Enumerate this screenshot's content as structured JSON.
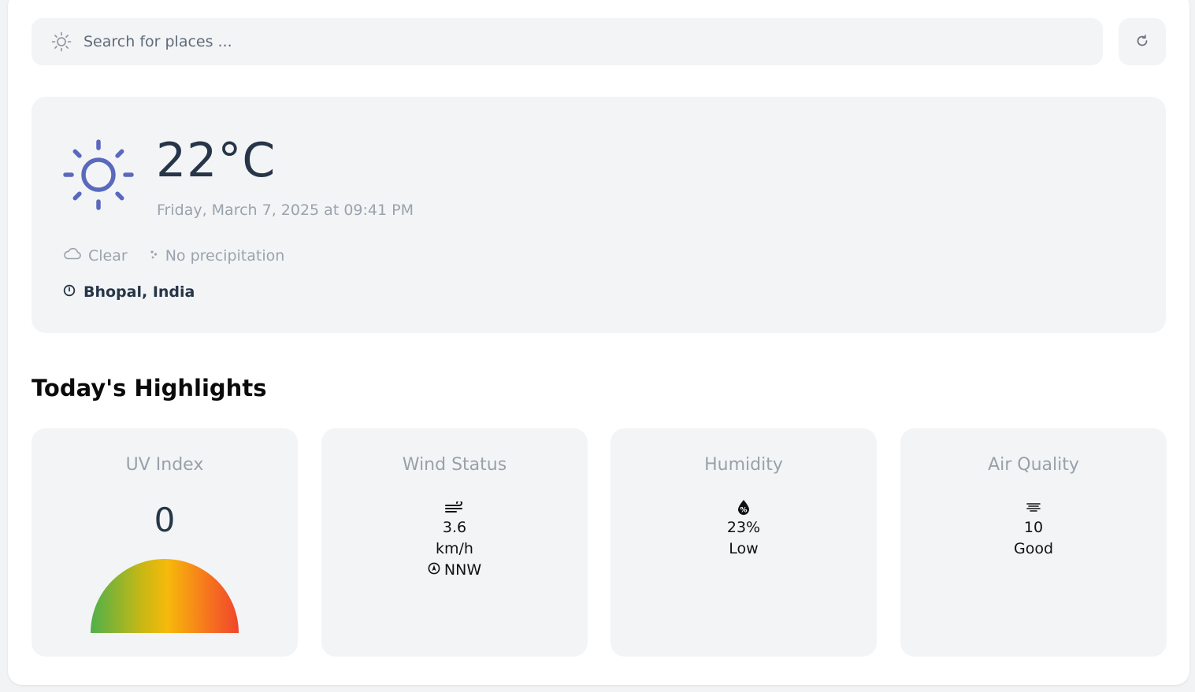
{
  "search": {
    "placeholder": "Search for places ..."
  },
  "current": {
    "temperature": "22°C",
    "datetime": "Friday, March 7, 2025 at 09:41 PM",
    "condition": "Clear",
    "precipitation": "No precipitation",
    "location": "Bhopal, India",
    "icon": "sun-icon"
  },
  "highlights": {
    "title": "Today's Highlights",
    "uv": {
      "title": "UV Index",
      "value": "0",
      "level": 0
    },
    "wind": {
      "title": "Wind Status",
      "speed": "3.6",
      "unit": "km/h",
      "direction": "NNW"
    },
    "humidity": {
      "title": "Humidity",
      "value": "23%",
      "label": "Low"
    },
    "air_quality": {
      "title": "Air Quality",
      "value": "10",
      "label": "Good"
    }
  },
  "colors": {
    "accent": "#5a68be",
    "card_bg": "#f3f4f6",
    "muted_text": "#9aa3ad",
    "dark_text": "#263548"
  }
}
